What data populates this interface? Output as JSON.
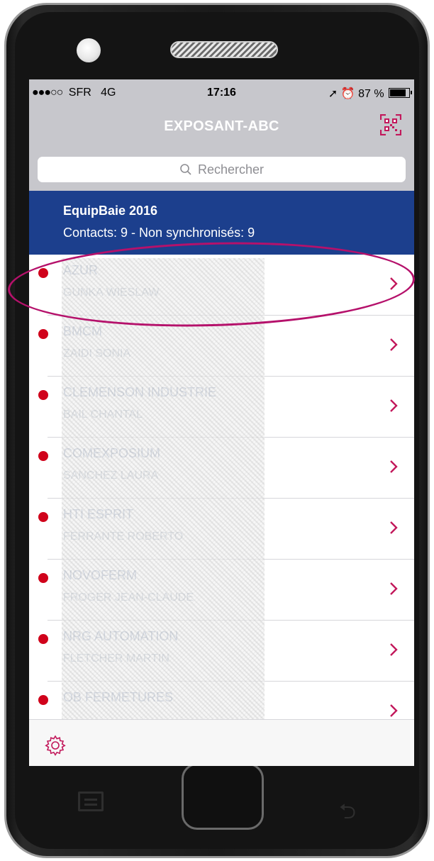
{
  "status_bar": {
    "carrier": "SFR",
    "network": "4G",
    "time": "17:16",
    "battery": "87 %",
    "battery_level": 0.87
  },
  "nav": {
    "title": "EXPOSANT-ABC",
    "qr_icon": "qr-code-scan-icon"
  },
  "search": {
    "placeholder": "Rechercher"
  },
  "event": {
    "title": "EquipBaie 2016",
    "subtitle": "Contacts: 9 - Non synchronisés: 9"
  },
  "contacts": [
    {
      "company": "AZUR",
      "person": "GUNKA WIESLAW",
      "synced": false
    },
    {
      "company": "BMCM",
      "person": "ZAIDI SONIA",
      "synced": false
    },
    {
      "company": "CLEMENSON INDUSTRIE",
      "person": "BAIL CHANTAL",
      "synced": false
    },
    {
      "company": "COMEXPOSIUM",
      "person": "SANCHEZ LAURA",
      "synced": false
    },
    {
      "company": "HTI ESPRIT",
      "person": "FERRANTE ROBERTO",
      "synced": false
    },
    {
      "company": "NOVOFERM",
      "person": "FROGER JEAN-CLAUDE",
      "synced": false
    },
    {
      "company": "NRG AUTOMATION",
      "person": "FLETCHER MARTIN",
      "synced": false
    },
    {
      "company": "OB FERMETURES",
      "person": "",
      "synced": false
    }
  ],
  "tabbar": {
    "settings_icon": "gear-icon"
  },
  "colors": {
    "event_banner": "#1c3f8d",
    "unsynced_dot": "#d0021b",
    "accent": "#c2185b",
    "highlight_ring": "#b5116b"
  }
}
